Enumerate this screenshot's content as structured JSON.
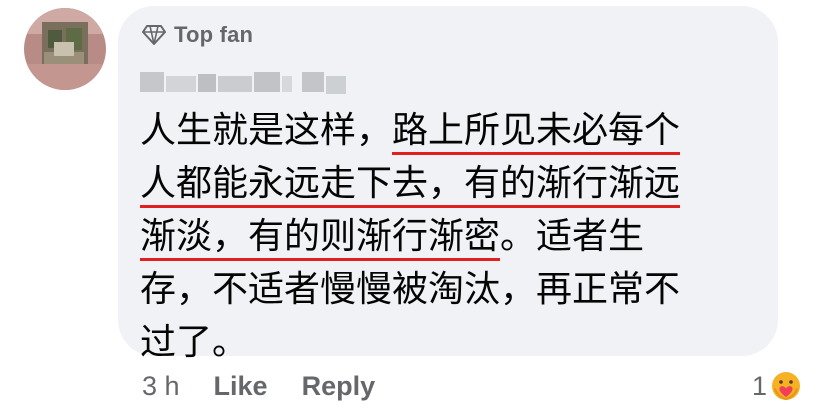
{
  "comment": {
    "badge_label": "Top fan",
    "text_lines": [
      {
        "plain": "人生就是这样，",
        "underlined": "路上所见未必每个"
      },
      {
        "plain": "",
        "underlined": "人都能永远走下去，有的渐行渐远"
      },
      {
        "plain_after": "。适者生",
        "underlined": "渐淡，有的则渐行渐密"
      },
      {
        "plain": "存，不适者慢慢被淘汰，再正常不"
      },
      {
        "plain": "过了。"
      }
    ]
  },
  "actions": {
    "time": "3 h",
    "like": "Like",
    "reply": "Reply"
  },
  "reactions": {
    "count": "1",
    "icon": "care-reaction-icon"
  },
  "colors": {
    "bubble_bg": "#f0f2f5",
    "meta_text": "#65676b",
    "underline": "#e0211f",
    "body_text": "#050505"
  }
}
